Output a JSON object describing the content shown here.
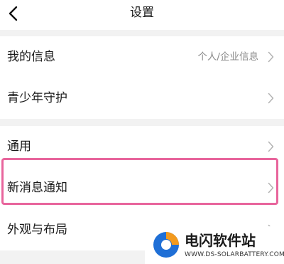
{
  "header": {
    "title": "设置",
    "back_icon": "chevron-left-icon"
  },
  "sections": [
    {
      "items": [
        {
          "label": "我的信息",
          "value": "个人/企业信息"
        },
        {
          "label": "青少年守护"
        }
      ]
    },
    {
      "items": [
        {
          "label": "通用"
        },
        {
          "label": "新消息通知",
          "highlighted": true
        },
        {
          "label": "外观与布局"
        }
      ]
    }
  ],
  "highlight_color": "#e8659c",
  "watermark": {
    "title": "电闪软件站",
    "url": "WWW.DS-SOLARBATTERY.COM"
  }
}
